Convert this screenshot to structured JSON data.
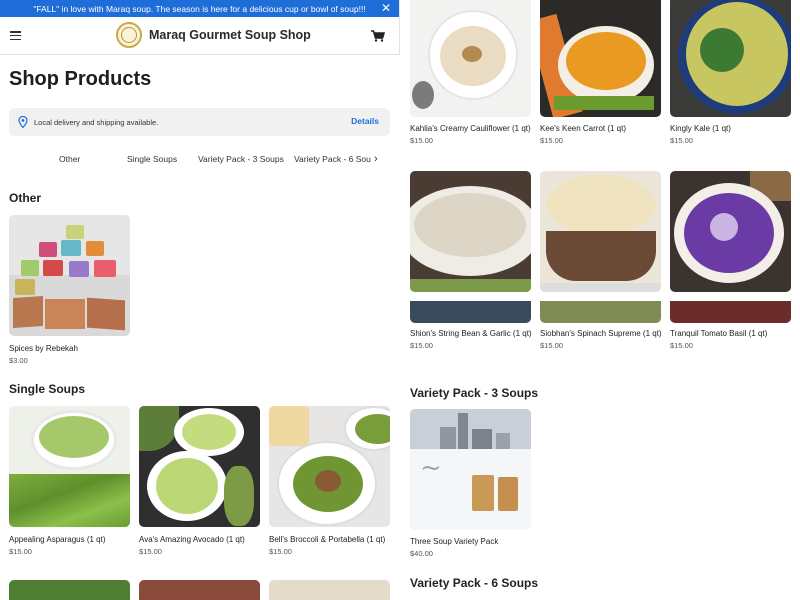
{
  "banner": {
    "text": "\"FALL\" in love with Maraq soup. The season is here for a delicious cup or bowl of soup!!!"
  },
  "header": {
    "brand": "Maraq Gourmet Soup Shop"
  },
  "page": {
    "title": "Shop Products"
  },
  "delivery": {
    "text": "Local delivery and shipping available.",
    "details_label": "Details"
  },
  "tabs": [
    "Other",
    "Single Soups",
    "Variety Pack - 3 Soups",
    "Variety Pack - 6 Sou"
  ],
  "sections": {
    "other": {
      "title": "Other",
      "products": [
        {
          "name": "Spices by Rebekah",
          "price": "$3.00"
        }
      ]
    },
    "single": {
      "title": "Single Soups",
      "products": [
        {
          "name": "Appealing Asparagus (1 qt)",
          "price": "$15.00"
        },
        {
          "name": "Ava's Amazing Avocado (1 qt)",
          "price": "$15.00"
        },
        {
          "name": "Bell's Broccoli & Portabella (1 qt)",
          "price": "$15.00"
        }
      ]
    },
    "right_top": [
      {
        "name": "Kahlia's Creamy Cauliflower (1 qt)",
        "price": "$15.00"
      },
      {
        "name": "Kee's Keen Carrot (1 qt)",
        "price": "$15.00"
      },
      {
        "name": "Kingly Kale (1 qt)",
        "price": "$15.00"
      }
    ],
    "right_mid": [
      {
        "name": "Shion's String Bean & Garlic (1 qt)",
        "price": "$15.00"
      },
      {
        "name": "Siobhan's Spinach Supreme (1 qt)",
        "price": "$15.00"
      },
      {
        "name": "Tranquil Tomato Basil (1 qt)",
        "price": "$15.00"
      }
    ],
    "variety3": {
      "title": "Variety Pack - 3 Soups",
      "products": [
        {
          "name": "Three Soup Variety Pack",
          "price": "$40.00"
        }
      ]
    },
    "variety6": {
      "title": "Variety Pack - 6 Soups"
    }
  },
  "colors": {
    "accent": "#1f6dd8"
  },
  "icons": {
    "menu": "hamburger-icon",
    "cart": "cart-icon",
    "close": "close-icon",
    "location": "location-pin-icon",
    "chevron": "chevron-right-icon"
  }
}
